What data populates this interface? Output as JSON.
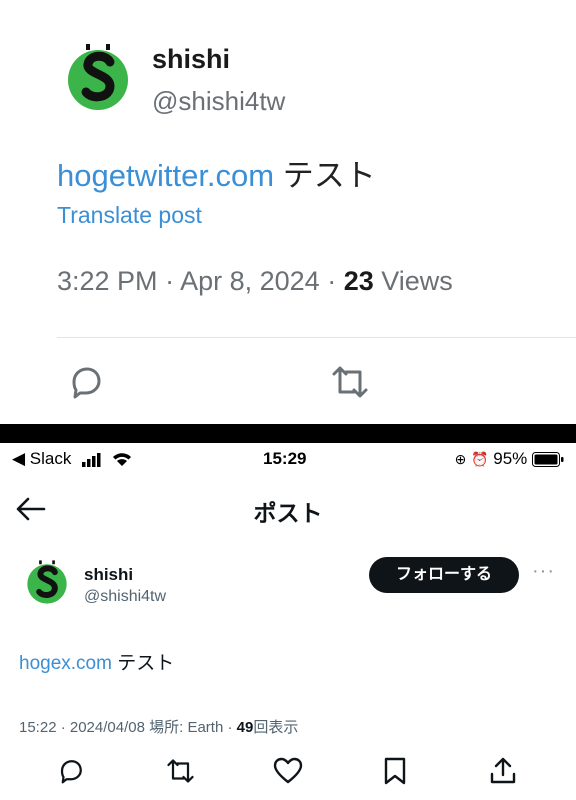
{
  "top_post": {
    "display_name": "shishi",
    "handle": "@shishi4tw",
    "link_text": "hogetwitter.com",
    "body_text": "テスト",
    "translate_label": "Translate post",
    "time": "3:22 PM",
    "date": "Apr 8, 2024",
    "view_count": "23",
    "views_label": "Views"
  },
  "status_bar": {
    "back_app": "◀ Slack",
    "time": "15:29",
    "battery": "95%"
  },
  "header": {
    "title": "ポスト"
  },
  "bottom_post": {
    "display_name": "shishi",
    "handle": "@shishi4tw",
    "follow_label": "フォローする",
    "more_label": "···",
    "link_text": "hogex.com",
    "body_text": "テスト",
    "datetime": "15:22 · 2024/04/08",
    "location_label": "場所: Earth",
    "view_count": "49",
    "views_label": "回表示"
  },
  "colors": {
    "link": "#3a8fd6",
    "avatar_green": "#3bb44a",
    "follow_bg": "#0f1419"
  },
  "icons": [
    "reply-icon",
    "retweet-icon",
    "like-icon",
    "bookmark-icon",
    "share-icon",
    "back-arrow-icon",
    "signal-icon",
    "wifi-icon",
    "battery-icon"
  ]
}
